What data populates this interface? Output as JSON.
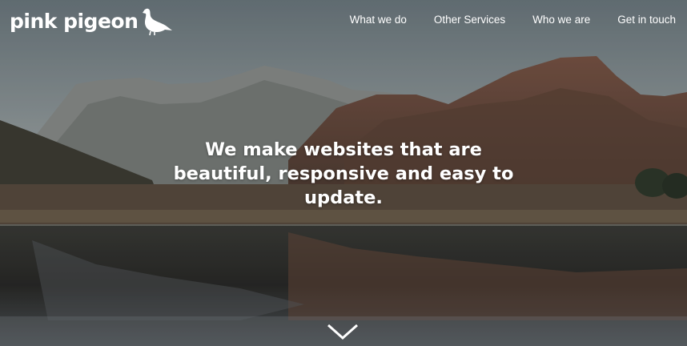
{
  "brand": {
    "name": "pink pigeon",
    "logo_icon": "pigeon-icon"
  },
  "nav": {
    "items": [
      {
        "label": "What we do"
      },
      {
        "label": "Other Services"
      },
      {
        "label": "Who we are"
      },
      {
        "label": "Get in touch"
      }
    ]
  },
  "hero": {
    "headline": "We make websites that are beautiful, responsive and easy to update.",
    "scroll_icon": "chevron-down-icon"
  },
  "colors": {
    "text": "#ffffff",
    "sky": "#9aa3a6",
    "water": "#2a2f31"
  }
}
